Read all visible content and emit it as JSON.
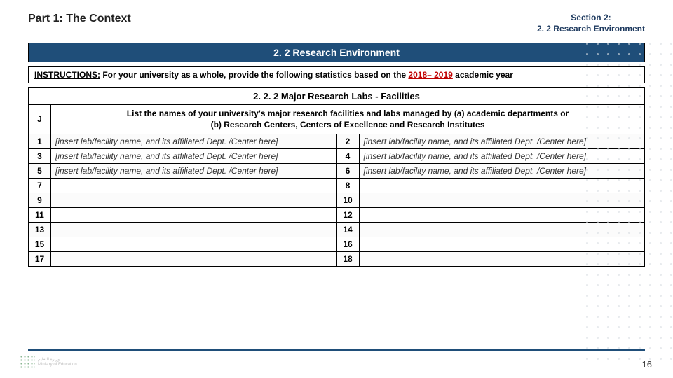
{
  "header": {
    "part_title": "Part 1: The Context",
    "section_line1": "Section 2:",
    "section_line2": "2. 2 Research Environment"
  },
  "bar_title": "2. 2 Research Environment",
  "instructions": {
    "lead": "INSTRUCTIONS:",
    "body_before": " For your university as a whole, provide the following statistics based on the ",
    "year": "2018– 2019",
    "body_after": " academic year"
  },
  "sub_title": "2. 2. 2 Major Research Labs - Facilities",
  "table": {
    "j_label": "J",
    "desc_line1": "List the names of your university's major research facilities and labs managed by (a) academic departments or",
    "desc_line2": "(b) Research Centers, Centers of Excellence and Research Institutes",
    "placeholder": "[insert lab/facility name, and its affiliated Dept. /Center here]",
    "rows": [
      {
        "l": "1",
        "lv": true,
        "r": "2",
        "rv": true
      },
      {
        "l": "3",
        "lv": true,
        "r": "4",
        "rv": true
      },
      {
        "l": "5",
        "lv": true,
        "r": "6",
        "rv": true
      },
      {
        "l": "7",
        "lv": false,
        "r": "8",
        "rv": false
      },
      {
        "l": "9",
        "lv": false,
        "r": "10",
        "rv": false
      },
      {
        "l": "11",
        "lv": false,
        "r": "12",
        "rv": false
      },
      {
        "l": "13",
        "lv": false,
        "r": "14",
        "rv": false
      },
      {
        "l": "15",
        "lv": false,
        "r": "16",
        "rv": false
      },
      {
        "l": "17",
        "lv": false,
        "r": "18",
        "rv": false
      }
    ]
  },
  "page_number": "16"
}
